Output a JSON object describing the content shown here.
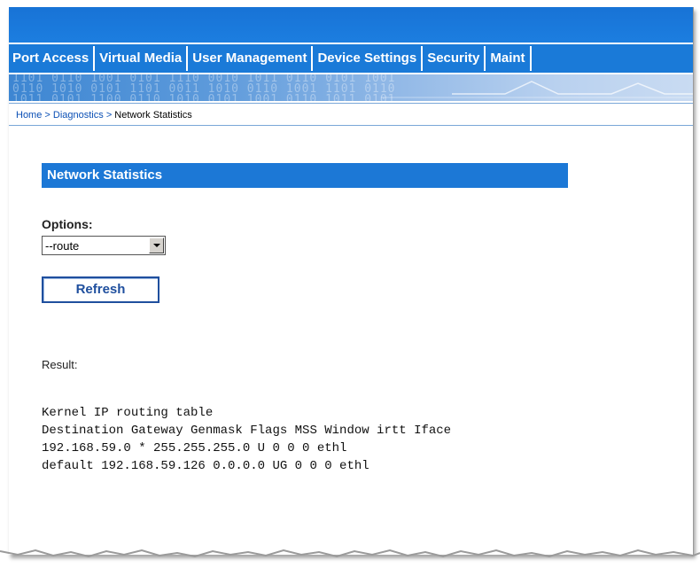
{
  "nav": {
    "tabs": [
      {
        "label": "Port Access"
      },
      {
        "label": "Virtual Media"
      },
      {
        "label": "User Management"
      },
      {
        "label": "Device Settings"
      },
      {
        "label": "Security"
      },
      {
        "label": "Maint"
      }
    ]
  },
  "breadcrumb": {
    "home": "Home",
    "separator": ">",
    "diagnostics": "Diagnostics",
    "current": "Network Statistics"
  },
  "section": {
    "title": "Network Statistics"
  },
  "options": {
    "label": "Options:",
    "selected": "--route"
  },
  "refresh": {
    "label": "Refresh"
  },
  "result": {
    "label": "Result:",
    "lines": [
      "Kernel IP routing table",
      "Destination Gateway Genmask Flags MSS Window irtt Iface",
      "192.168.59.0 * 255.255.255.0 U 0 0 0 ethl",
      "default 192.168.59.126 0.0.0.0 UG 0 0 0 ethl"
    ]
  },
  "colors": {
    "nav_blue": "#1a7ad8",
    "header_blue": "#1c78d6",
    "link_blue": "#0a4fb5",
    "button_border": "#1f4f9e"
  }
}
